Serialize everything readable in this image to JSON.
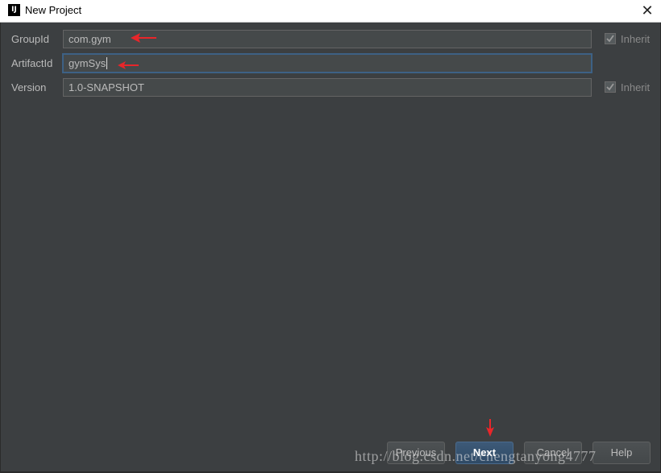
{
  "window": {
    "title": "New Project",
    "app_icon_text": "IJ",
    "close_glyph": "✕"
  },
  "form": {
    "group_id": {
      "label": "GroupId",
      "value": "com.gym",
      "inherit_label": "Inherit",
      "inherit_checked": true
    },
    "artifact_id": {
      "label": "ArtifactId",
      "value": "gymSys"
    },
    "version": {
      "label": "Version",
      "value": "1.0-SNAPSHOT",
      "inherit_label": "Inherit",
      "inherit_checked": true
    }
  },
  "buttons": {
    "previous": "Previous",
    "next": "Next",
    "cancel": "Cancel",
    "help": "Help"
  },
  "watermark": "http://blog.csdn.net/chengtanyong4777",
  "colors": {
    "background": "#3c3f41",
    "field_bg": "#45494a",
    "text": "#bbbbbb",
    "annotation_arrow": "#e8262a",
    "focus_border": "#3d6185"
  },
  "icons": {
    "app": "intellij-logo-icon",
    "close": "close-icon",
    "check": "checkmark-icon",
    "arrow": "red-annotation-arrow"
  }
}
